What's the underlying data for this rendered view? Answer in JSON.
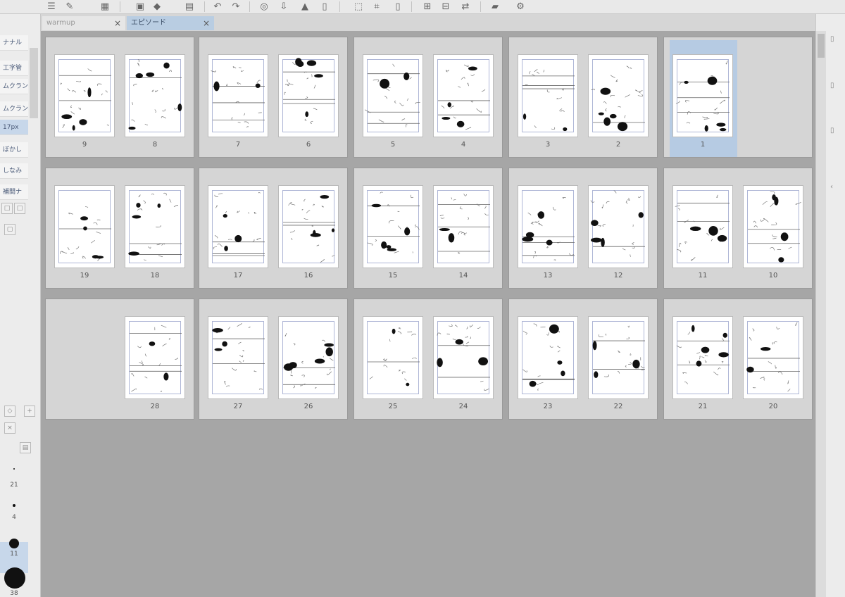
{
  "tabs": [
    {
      "label": "warmup",
      "close": "×"
    },
    {
      "label": "エピソード",
      "close": "×"
    }
  ],
  "left_panel": {
    "items": [
      "ナナル",
      "工字管",
      "ムクラン",
      "ムクラン",
      "17px",
      "ぼかし",
      "しなみ",
      "補間ナ"
    ],
    "brush_sizes": [
      "21",
      "4",
      "11",
      "38"
    ]
  },
  "spreads": [
    {
      "left_num": "9",
      "right_num": "8"
    },
    {
      "left_num": "7",
      "right_num": "6"
    },
    {
      "left_num": "5",
      "right_num": "4"
    },
    {
      "left_num": "3",
      "right_num": "2"
    },
    {
      "left_num": "",
      "right_num": "1"
    },
    {
      "left_num": "19",
      "right_num": "18"
    },
    {
      "left_num": "17",
      "right_num": "16"
    },
    {
      "left_num": "15",
      "right_num": "14"
    },
    {
      "left_num": "13",
      "right_num": "12"
    },
    {
      "left_num": "11",
      "right_num": "10"
    },
    {
      "left_num": "",
      "right_num": "28"
    },
    {
      "left_num": "27",
      "right_num": "26"
    },
    {
      "left_num": "25",
      "right_num": "24"
    },
    {
      "left_num": "23",
      "right_num": "22"
    },
    {
      "left_num": "21",
      "right_num": "20"
    }
  ],
  "selected_page": "1",
  "colors": {
    "accent": "#b6cbe3",
    "canvas": "#a6a6a6",
    "spread": "#d5d5d5"
  },
  "icons": [
    "menu-icon",
    "new-file-icon",
    "grid-icon",
    "save-icon",
    "undo-icon",
    "redo-icon",
    "zoom-icon",
    "settings-icon"
  ]
}
